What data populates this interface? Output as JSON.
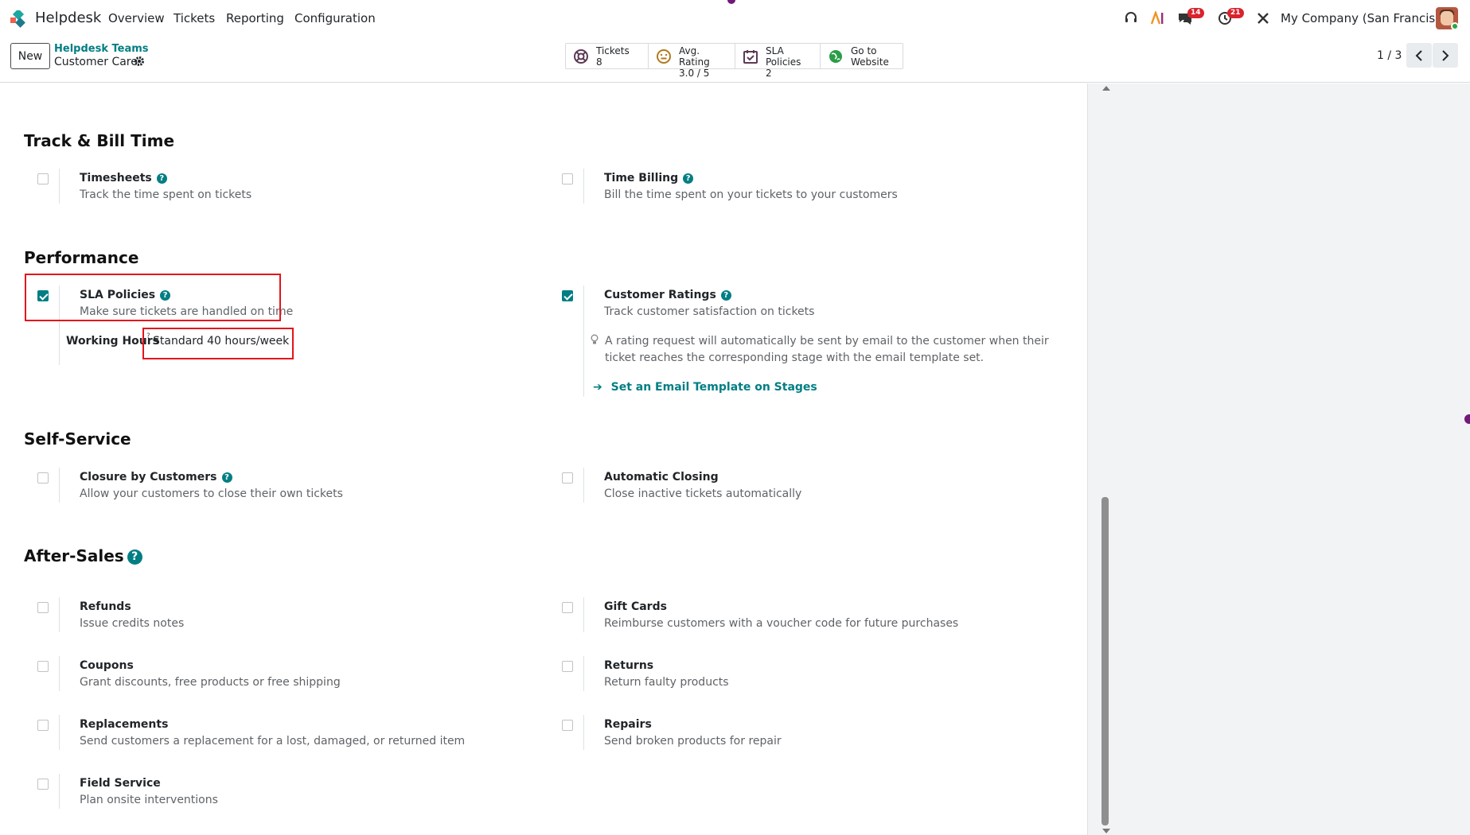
{
  "navbar": {
    "app_name": "Helpdesk",
    "menu": [
      "Overview",
      "Tickets",
      "Reporting",
      "Configuration"
    ],
    "badges": {
      "discuss": "14",
      "activity": "21"
    },
    "company": "My Company (San Francisco)"
  },
  "control": {
    "new_label": "New",
    "breadcrumb": "Helpdesk Teams",
    "record_title": "Customer Care",
    "stats": [
      {
        "label": "Tickets",
        "value": "8",
        "icon": "lifebuoy-icon"
      },
      {
        "label": "Avg. Rating",
        "value": "3.0 / 5",
        "icon": "smiley-icon"
      },
      {
        "label": "SLA Policies",
        "value": "2",
        "icon": "calendar-check-icon"
      },
      {
        "label": "Go to",
        "value": "Website",
        "icon": "globe-icon"
      }
    ],
    "pager": "1 / 3"
  },
  "sections": {
    "track": "Track & Bill Time",
    "performance": "Performance",
    "self_service": "Self-Service",
    "after_sales": "After-Sales"
  },
  "settings": {
    "timesheets": {
      "label": "Timesheets",
      "desc": "Track the time spent on tickets",
      "checked": false
    },
    "time_billing": {
      "label": "Time Billing",
      "desc": "Bill the time spent on your tickets to your customers",
      "checked": false
    },
    "sla": {
      "label": "SLA Policies",
      "desc": "Make sure tickets are handled on time",
      "checked": true
    },
    "ratings": {
      "label": "Customer Ratings",
      "desc": "Track customer satisfaction on tickets",
      "checked": true
    },
    "closure": {
      "label": "Closure by Customers",
      "desc": "Allow your customers to close their own tickets",
      "checked": false
    },
    "auto_close": {
      "label": "Automatic Closing",
      "desc": "Close inactive tickets automatically",
      "checked": false
    },
    "refunds": {
      "label": "Refunds",
      "desc": "Issue credits notes",
      "checked": false
    },
    "gift_cards": {
      "label": "Gift Cards",
      "desc": "Reimburse customers with a voucher code for future purchases",
      "checked": false
    },
    "coupons": {
      "label": "Coupons",
      "desc": "Grant discounts, free products or free shipping",
      "checked": false
    },
    "returns": {
      "label": "Returns",
      "desc": "Return faulty products",
      "checked": false
    },
    "replacements": {
      "label": "Replacements",
      "desc": "Send customers a replacement for a lost, damaged, or returned item",
      "checked": false
    },
    "repairs": {
      "label": "Repairs",
      "desc": "Send broken products for repair",
      "checked": false
    },
    "field_service": {
      "label": "Field Service",
      "desc": "Plan onsite interventions",
      "checked": false
    }
  },
  "working_hours": {
    "label": "Working Hours",
    "q": "?",
    "value": "Standard 40 hours/week"
  },
  "ratings_info": {
    "text": "A rating request will automatically be sent by email to the customer when their ticket reaches the corresponding stage with the email template set.",
    "link": "Set an Email Template on Stages"
  },
  "colors": {
    "accent": "#017e84",
    "highlight": "#e4141c",
    "badge": "#d9232d"
  }
}
